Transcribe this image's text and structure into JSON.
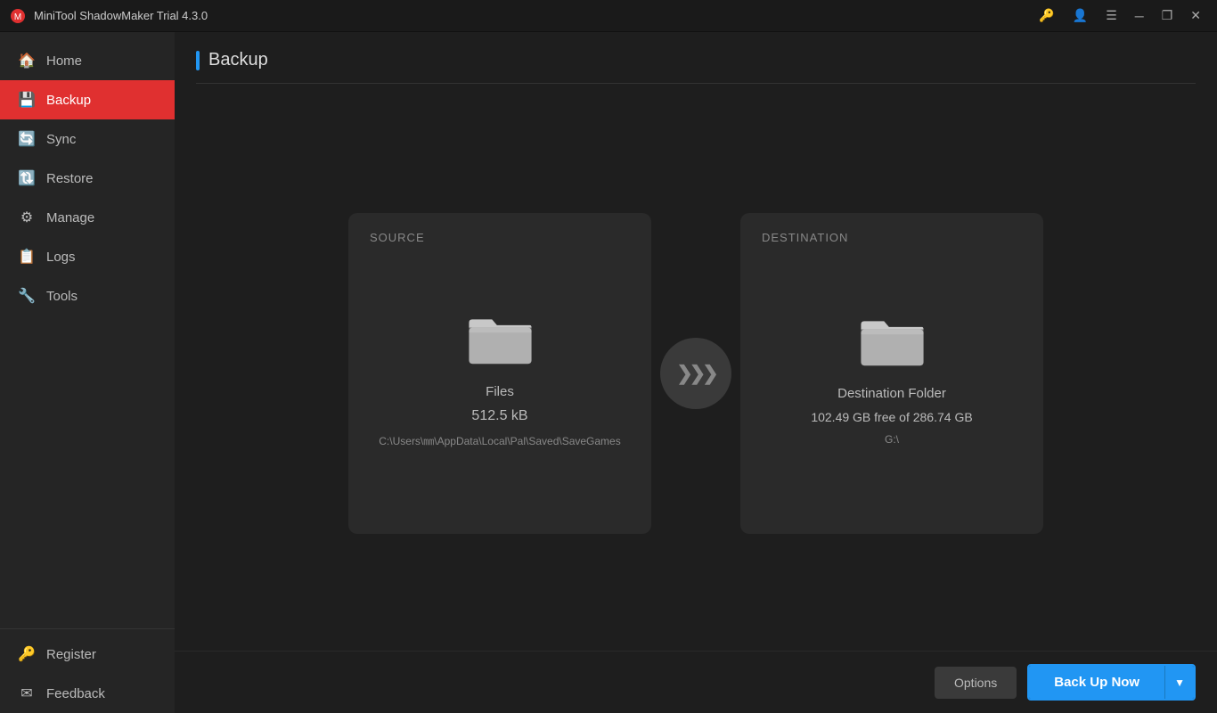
{
  "titlebar": {
    "app_name": "MiniTool ShadowMaker Trial 4.3.0",
    "icons": {
      "key": "🔑",
      "person": "👤",
      "menu": "☰",
      "minimize": "─",
      "restore": "❐",
      "close": "✕"
    }
  },
  "sidebar": {
    "items": [
      {
        "id": "home",
        "label": "Home",
        "icon": "🏠",
        "active": false
      },
      {
        "id": "backup",
        "label": "Backup",
        "icon": "💾",
        "active": true
      },
      {
        "id": "sync",
        "label": "Sync",
        "icon": "🔄",
        "active": false
      },
      {
        "id": "restore",
        "label": "Restore",
        "icon": "🔃",
        "active": false
      },
      {
        "id": "manage",
        "label": "Manage",
        "icon": "⚙",
        "active": false
      },
      {
        "id": "logs",
        "label": "Logs",
        "icon": "📋",
        "active": false
      },
      {
        "id": "tools",
        "label": "Tools",
        "icon": "🔧",
        "active": false
      }
    ],
    "bottom_items": [
      {
        "id": "register",
        "label": "Register",
        "icon": "🔑"
      },
      {
        "id": "feedback",
        "label": "Feedback",
        "icon": "✉"
      }
    ]
  },
  "page": {
    "title": "Backup"
  },
  "source_card": {
    "label": "SOURCE",
    "type": "Files",
    "size": "512.5 kB",
    "path": "C:\\Users\\㎜\\AppData\\Local\\Pal\\Saved\\SaveGames"
  },
  "destination_card": {
    "label": "DESTINATION",
    "type": "Destination Folder",
    "free": "102.49 GB free of 286.74 GB",
    "path": "G:\\"
  },
  "bottom_bar": {
    "options_label": "Options",
    "backup_now_label": "Back Up Now"
  }
}
